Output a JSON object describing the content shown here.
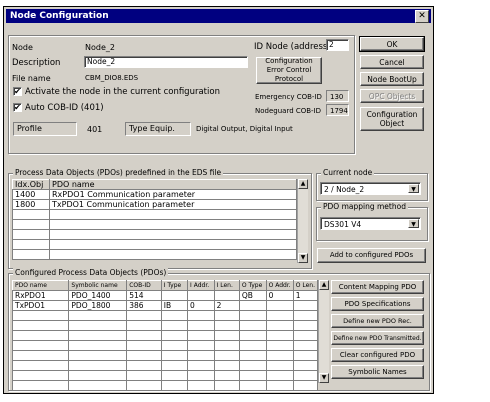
{
  "window": {
    "title": "Node Configuration",
    "close_label": "✕"
  },
  "node": {
    "node_label": "Node",
    "node_value": "Node_2",
    "id_label": "ID Node (address)",
    "id_value": "2",
    "description_label": "Description",
    "description_value": "Node_2",
    "filename_label": "File name",
    "filename_value": "CBM_DIO8.EDS",
    "activate_label": "Activate the node in the current configuration",
    "activate_checked": "✔",
    "autocob_label": "Auto COB-ID (401)",
    "autocob_checked": "✔",
    "profile_label": "Profile",
    "profile_value": "401",
    "type_label": "Type Equip.",
    "type_value": "Digital Output, Digital Input",
    "config_error_label": "Configuration  Error Control  Protocol",
    "emergency_label": "Emergency COB-ID",
    "emergency_value": "130",
    "nodeguard_label": "Nodeguard COB-ID",
    "nodeguard_value": "1794"
  },
  "side_buttons": {
    "ok": "OK",
    "cancel": "Cancel",
    "node_bootup": "Node  BootUp",
    "opc_objects": "OPC Objects",
    "configuration_object": "Configuration Object"
  },
  "predefined": {
    "legend": "Process Data Objects (PDOs) predefined in the EDS file",
    "columns": [
      "Idx.Obj",
      "PDO name"
    ],
    "rows": [
      [
        "1400",
        "RxPDO1 Communication parameter"
      ],
      [
        "1800",
        "TxPDO1 Communication parameter"
      ]
    ]
  },
  "current_node": {
    "legend": "Current node",
    "value": "2 / Node_2"
  },
  "mapping": {
    "legend": "PDO mapping method",
    "value": "DS301 V4"
  },
  "add_button": "Add to configured PDOs",
  "configured": {
    "legend": "Configured Process Data Objects (PDOs)",
    "columns": [
      "PDO name",
      "Symbolic name",
      "COB-ID",
      "I Type",
      "I Addr.",
      "I Len.",
      "O Type",
      "O Addr.",
      "O Len."
    ],
    "rows": [
      [
        "RxPDO1",
        "PDO_1400",
        "514",
        "",
        "",
        "",
        "QB",
        "0",
        "1"
      ],
      [
        "TxPDO1",
        "PDO_1800",
        "386",
        "IB",
        "0",
        "2",
        "",
        "",
        ""
      ]
    ]
  },
  "pdo_buttons": {
    "content_mapping": "Content  Mapping  PDO",
    "specifications": "PDO  Specifications",
    "define_received": "Define  new  PDO  Rec.",
    "define_transmitted": "Define  new  PDO  Transmitted.",
    "clear": "Clear  configured  PDO",
    "symbolic": "Symbolic  Names"
  },
  "icons": {
    "arrow_up": "▲",
    "arrow_down": "▼"
  }
}
